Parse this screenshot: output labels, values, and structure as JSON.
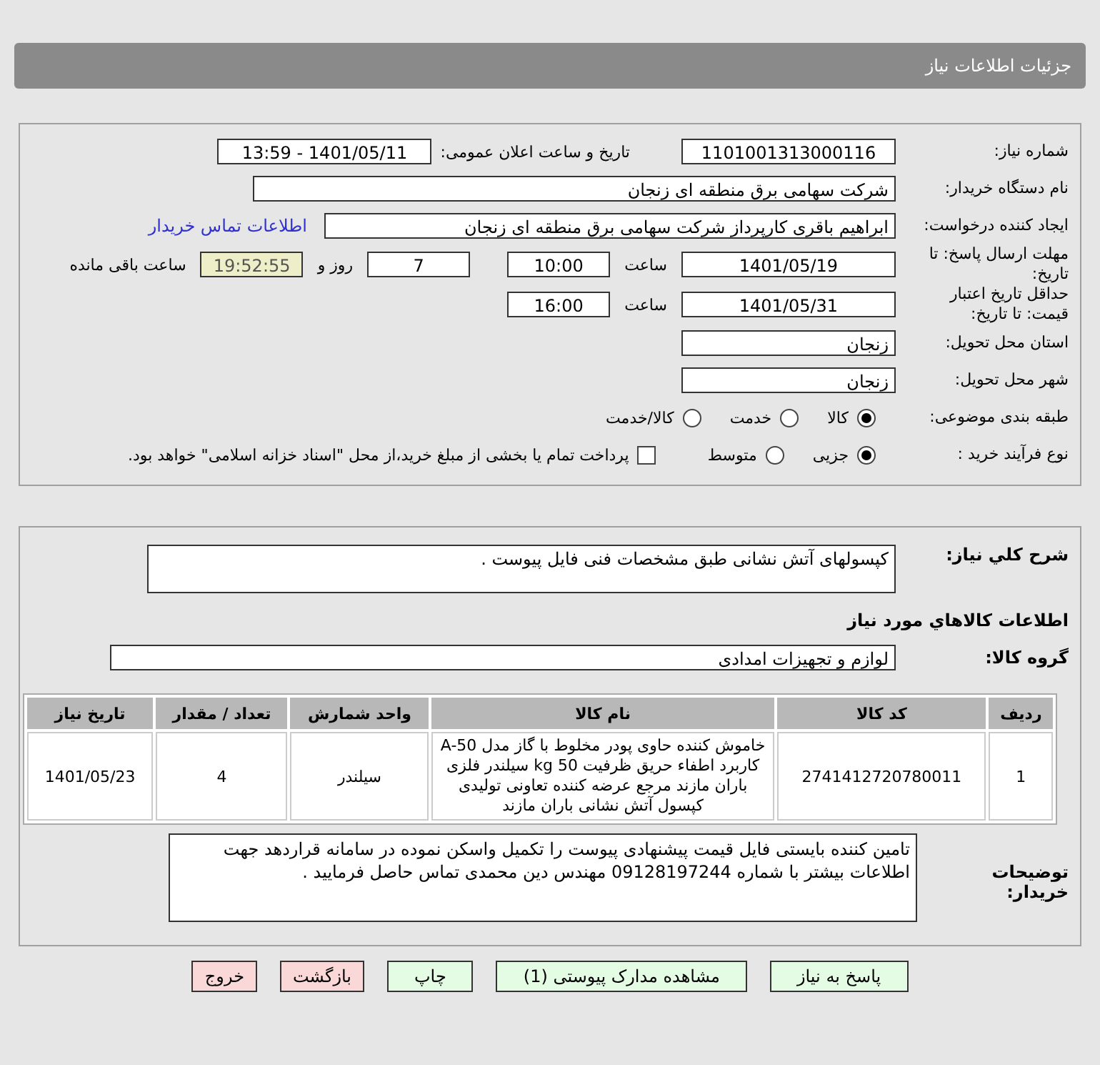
{
  "header": {
    "title": "جزئیات اطلاعات نیاز"
  },
  "details": {
    "need_number": {
      "label": "شماره نیاز:",
      "value": "1101001313000116"
    },
    "announce": {
      "label": "تاریخ و ساعت اعلان عمومی:",
      "value": "1401/05/11 - 13:59"
    },
    "buyer_org": {
      "label": "نام دستگاه خریدار:",
      "value": "شرکت سهامی برق منطقه ای زنجان"
    },
    "requester": {
      "label": "ایجاد کننده درخواست:",
      "value": "ابراهیم باقری کارپرداز شرکت سهامی برق منطقه ای زنجان",
      "link": "اطلاعات تماس خریدار"
    },
    "deadline": {
      "label": "مهلت ارسال پاسخ: تا تاریخ:",
      "date": "1401/05/19",
      "time_label": "ساعت",
      "time": "10:00",
      "days": "7",
      "days_label": "روز و",
      "remaining": "19:52:55",
      "remaining_label": "ساعت باقی مانده"
    },
    "validity": {
      "label": "حداقل تاریخ اعتبار قیمت: تا تاریخ:",
      "date": "1401/05/31",
      "time_label": "ساعت",
      "time": "16:00"
    },
    "province": {
      "label": "استان محل تحویل:",
      "value": "زنجان"
    },
    "city": {
      "label": "شهر محل تحویل:",
      "value": "زنجان"
    },
    "category": {
      "label": "طبقه بندی موضوعی:",
      "options": [
        {
          "label": "کالا",
          "selected": true
        },
        {
          "label": "خدمت",
          "selected": false
        },
        {
          "label": "کالا/خدمت",
          "selected": false
        }
      ]
    },
    "process": {
      "label": "نوع فرآیند خرید :",
      "options": [
        {
          "label": "جزیی",
          "selected": true
        },
        {
          "label": "متوسط",
          "selected": false
        }
      ],
      "payment": {
        "checked": false,
        "label": "پرداخت تمام یا بخشی از مبلغ خرید،از محل \"اسناد خزانه اسلامی\" خواهد بود."
      }
    }
  },
  "summary": {
    "label": "شرح كلي نياز:",
    "value": "کپسولهای آتش نشانی طبق مشخصات فنی فایل پیوست  ."
  },
  "goods_title": "اطلاعات كالاهاي مورد نياز",
  "goods_group": {
    "label": "گروه کالا:",
    "value": "لوازم و تجهیزات امدادی"
  },
  "table": {
    "columns": [
      "ردیف",
      "کد کالا",
      "نام کالا",
      "واحد شمارش",
      "تعداد / مقدار",
      "تاریخ نیاز"
    ],
    "rows": [
      [
        "1",
        "2741412720780011",
        "خاموش کننده حاوی پودر مخلوط با گاز مدل A-50 کاربرد اطفاء حریق ظرفیت 50 kg سیلندر فلزی باران مازند مرجع عرضه کننده تعاونی تولیدی کپسول آتش نشانی باران مازند",
        "سیلندر",
        "4",
        "1401/05/23"
      ]
    ]
  },
  "buyer_notes": {
    "label": "توضیحات خریدار:",
    "value": "تامین کننده بایستی فایل قیمت پیشنهادی پیوست را تکمیل واسکن نموده در سامانه قراردهد جهت اطلاعات بیشتر با شماره 09128197244 مهندس دین محمدی تماس حاصل فرمایید ."
  },
  "buttons": [
    {
      "label": "پاسخ به نیاز",
      "kind": "primary"
    },
    {
      "label": "مشاهده مدارک پیوستی (1)",
      "kind": "primary"
    },
    {
      "label": "چاپ",
      "kind": "primary"
    },
    {
      "label": "بازگشت",
      "kind": "danger"
    },
    {
      "label": "خروج",
      "kind": "danger"
    }
  ]
}
